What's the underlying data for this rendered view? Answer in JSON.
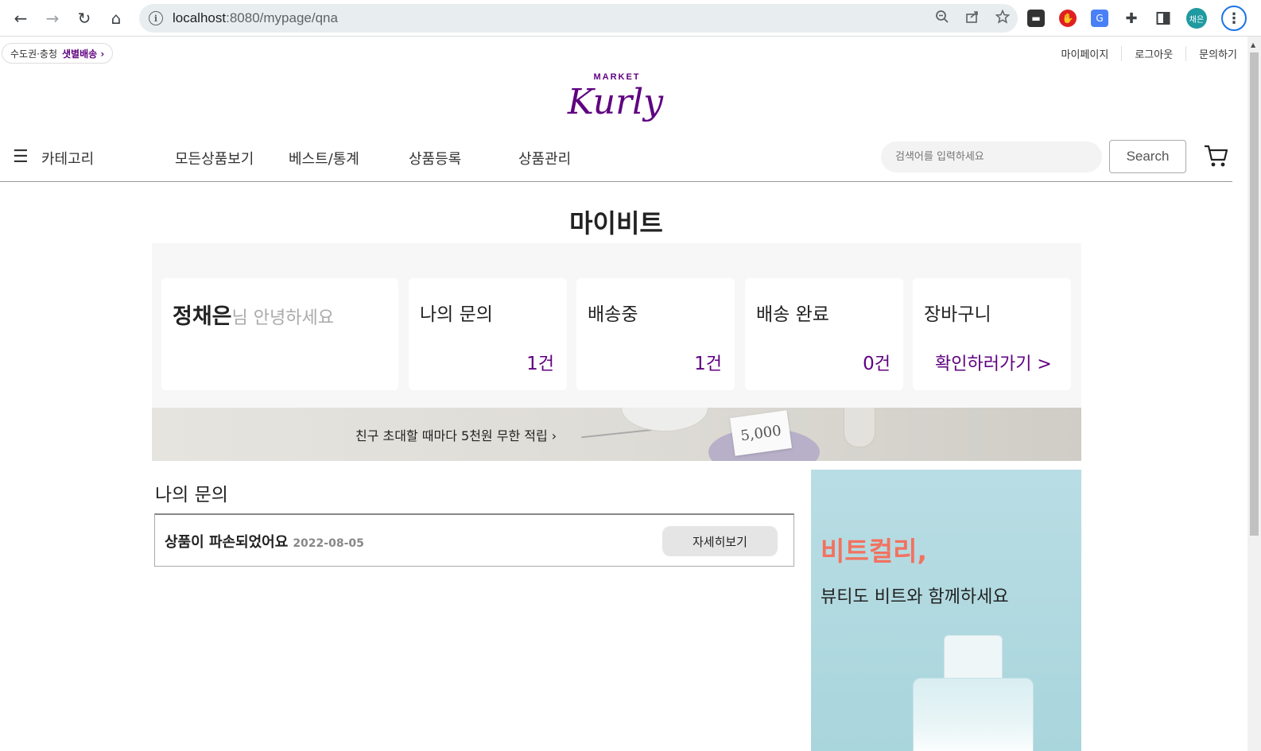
{
  "browser": {
    "url_host": "localhost",
    "url_path": ":8080/mypage/qna",
    "profile_label": "채은"
  },
  "header": {
    "delivery_prefix": "수도권·충청",
    "delivery_highlight": "샛별배송 ›",
    "links": [
      "마이페이지",
      "로그아웃",
      "문의하기"
    ],
    "logo_market": "MARKET",
    "logo_kurly": "Kurly"
  },
  "gnb": {
    "category_label": "카테고리",
    "menu": [
      "모든상품보기",
      "베스트/통계",
      "상품등록",
      "상품관리"
    ],
    "search_placeholder": "검색어를 입력하세요",
    "search_button": "Search"
  },
  "page": {
    "title": "마이비트"
  },
  "summary": {
    "user_name": "정채은",
    "greeting": "님 안녕하세요",
    "cards": [
      {
        "title": "나의 문의",
        "count": "1",
        "unit": "건"
      },
      {
        "title": "배송중",
        "count": "1",
        "unit": "건"
      },
      {
        "title": "배송 완료",
        "count": "0",
        "unit": "건"
      }
    ],
    "cart_title": "장바구니",
    "cart_link": "확인하러가기 >"
  },
  "banner": {
    "text": "친구 초대할 때마다 5천원 무한 적립 ›",
    "card_value": "5,000"
  },
  "qna": {
    "section_title": "나의 문의",
    "items": [
      {
        "title": "상품이 파손되었어요",
        "date": "2022-08-05",
        "button": "자세히보기"
      }
    ]
  },
  "ad": {
    "title": "비트컬리,",
    "subtitle": "뷰티도 비트와 함께하세요"
  },
  "colors": {
    "brand": "#5f0080",
    "ad_title": "#f27260",
    "ad_bg": "#b9dde4"
  }
}
